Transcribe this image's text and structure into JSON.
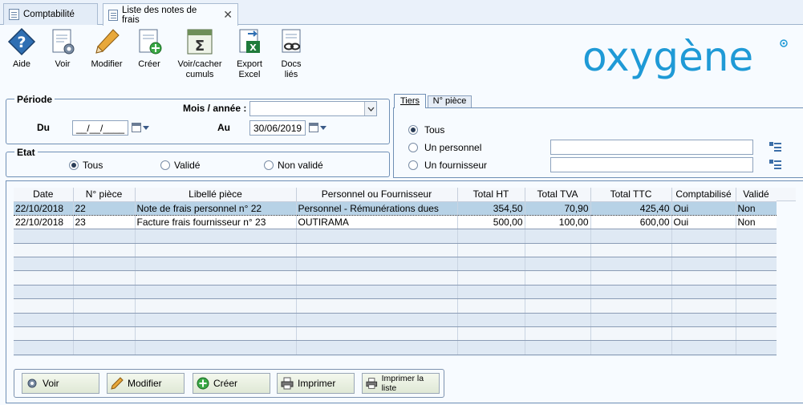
{
  "tabs": [
    {
      "label": "Comptabilité"
    },
    {
      "label": "Liste des notes de frais"
    }
  ],
  "toolbar": {
    "aide": "Aide",
    "voir": "Voir",
    "modifier": "Modifier",
    "creer": "Créer",
    "cumuls_1": "Voir/cacher",
    "cumuls_2": "cumuls",
    "export_1": "Export",
    "export_2": "Excel",
    "docs_1": "Docs",
    "docs_2": "liés"
  },
  "logo": {
    "text": "oxygène",
    "color": "#1f9ad6"
  },
  "periode": {
    "title": "Période",
    "mois_label": "Mois / année :",
    "mois_value": "",
    "du_label": "Du",
    "du_value": "__/__/____",
    "au_label": "Au",
    "au_value": "30/06/2019"
  },
  "etat": {
    "title": "Etat",
    "options": [
      "Tous",
      "Validé",
      "Non validé"
    ],
    "selected": "Tous"
  },
  "tiers": {
    "tabs": [
      "Tiers",
      "N° pièce"
    ],
    "options": [
      "Tous",
      "Un personnel",
      "Un fournisseur"
    ],
    "selected": "Tous"
  },
  "table": {
    "columns": [
      "Date",
      "N° pièce",
      "Libellé pièce",
      "Personnel ou Fournisseur",
      "Total HT",
      "Total TVA",
      "Total TTC",
      "Comptabilisé",
      "Validé"
    ],
    "rows": [
      [
        "22/10/2018",
        "22",
        "Note de frais personnel n° 22",
        "Personnel - Rémunérations dues",
        "354,50",
        "70,90",
        "425,40",
        "Oui",
        "Non"
      ],
      [
        "22/10/2018",
        "23",
        "Facture frais fournisseur n° 23",
        "OUTIRAMA",
        "500,00",
        "100,00",
        "600,00",
        "Oui",
        "Non"
      ]
    ],
    "selected_row": 0
  },
  "bottom_buttons": {
    "voir": "Voir",
    "modifier": "Modifier",
    "creer": "Créer",
    "imprimer": "Imprimer",
    "imprimer_liste": "Imprimer la liste"
  }
}
